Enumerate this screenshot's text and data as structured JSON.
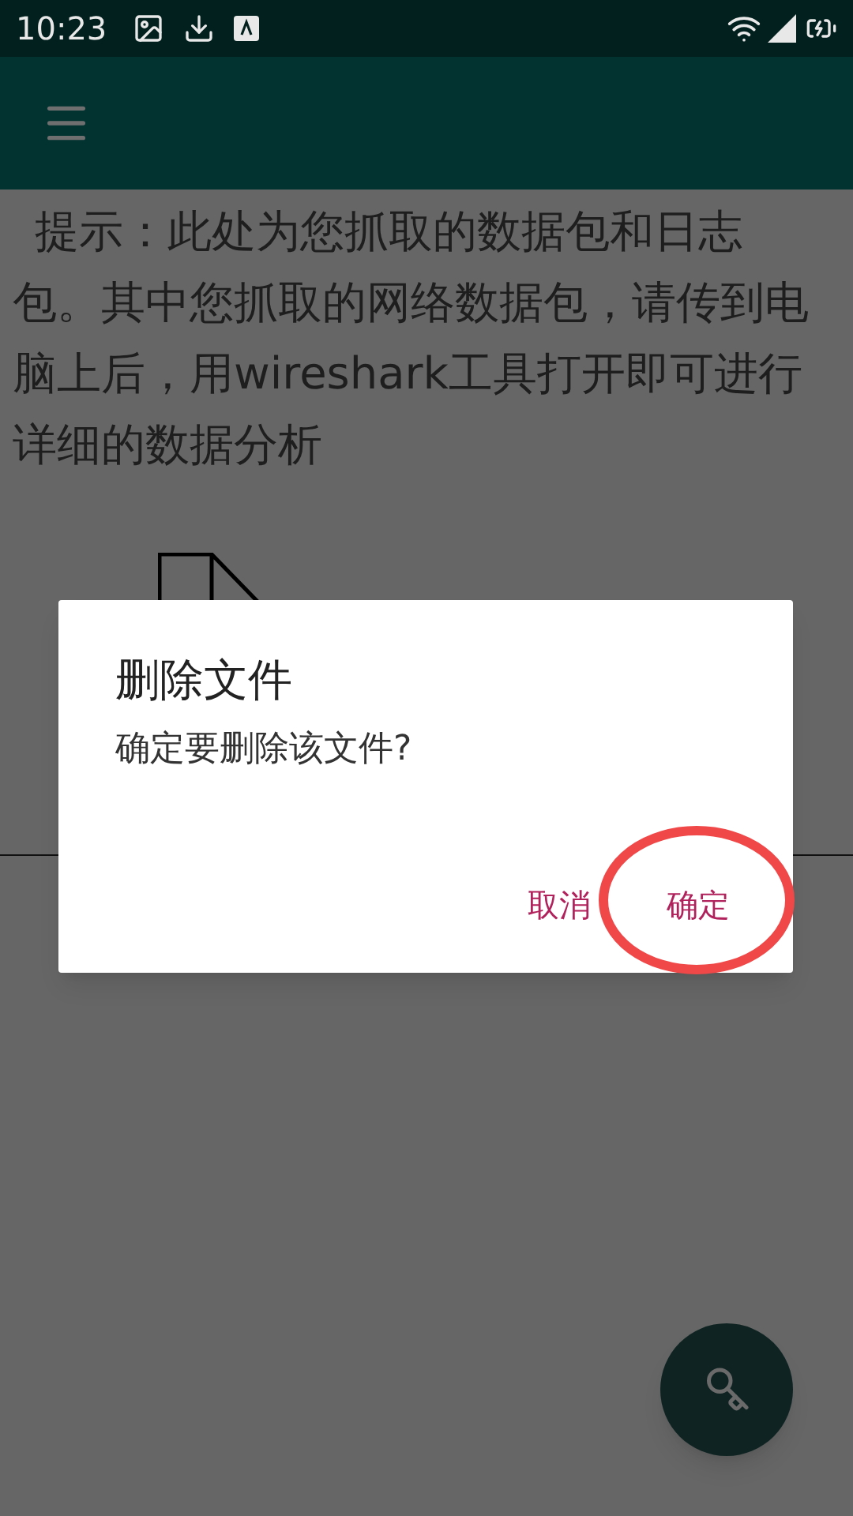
{
  "status_bar": {
    "time": "10:23"
  },
  "hint": "提示：此处为您抓取的数据包和日志包。其中您抓取的网络数据包，请传到电脑上后，用wireshark工具打开即可进行详细的数据分析",
  "dialog": {
    "title": "删除文件",
    "message": "确定要删除该文件?",
    "buttons": [
      {
        "label": "取消"
      },
      {
        "label": "确定"
      }
    ]
  }
}
